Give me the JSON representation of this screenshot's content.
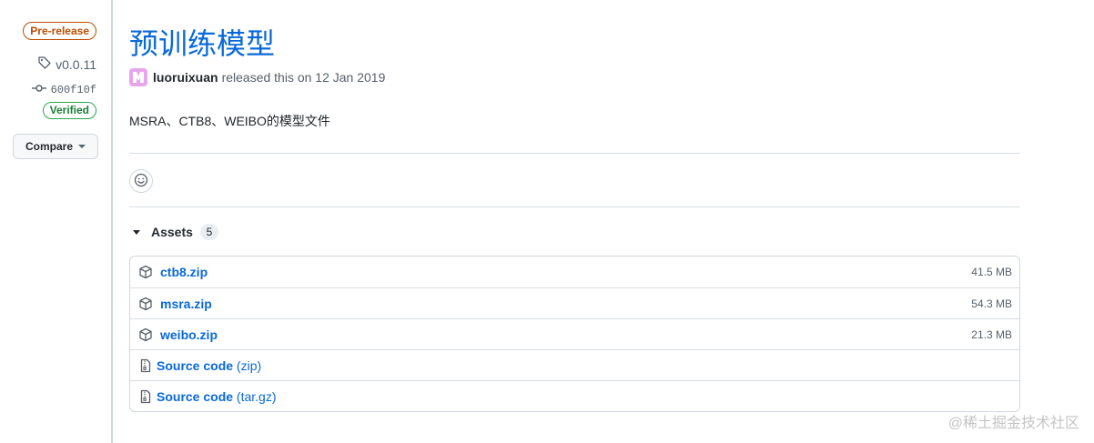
{
  "sidebar": {
    "prerelease_label": "Pre-release",
    "tag_label": "v0.0.11",
    "commit_label": "600f10f",
    "verified_label": "Verified",
    "compare_label": "Compare"
  },
  "release": {
    "title": "预训练模型",
    "author": "luoruixuan",
    "released_text": "released this on 12 Jan 2019",
    "description": "MSRA、CTB8、WEIBO的模型文件"
  },
  "assets": {
    "label": "Assets",
    "count": "5",
    "files": [
      {
        "name": "ctb8.zip",
        "size": "41.5 MB"
      },
      {
        "name": "msra.zip",
        "size": "54.3 MB"
      },
      {
        "name": "weibo.zip",
        "size": "21.3 MB"
      }
    ],
    "source": [
      {
        "label": "Source code",
        "ext": "(zip)"
      },
      {
        "label": "Source code",
        "ext": "(tar.gz)"
      }
    ]
  },
  "watermark": "@稀土掘金技术社区",
  "icons": [
    "tag-icon",
    "commit-icon",
    "chevron-down-icon",
    "smiley-icon",
    "triangle-down-icon",
    "package-icon",
    "file-zip-icon"
  ],
  "colors": {
    "link": "#0969da",
    "prerelease": "#bc4c00",
    "verified": "#1a7f37",
    "avatar": "#e7a6ec"
  }
}
